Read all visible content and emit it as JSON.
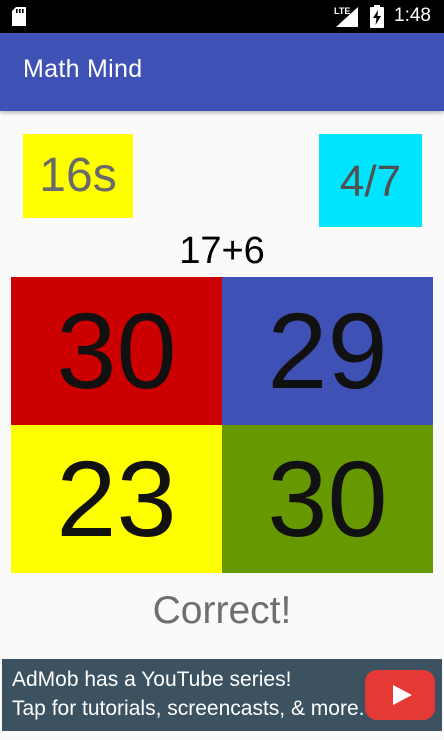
{
  "status_bar": {
    "network": "LTE",
    "time": "1:48"
  },
  "app_bar": {
    "title": "Math Mind"
  },
  "game": {
    "timer": "16s",
    "score": "4/7",
    "problem": "17+6",
    "answers": [
      "30",
      "29",
      "23",
      "30"
    ],
    "answer_colors": [
      "#cc0000",
      "#3f51b5",
      "#ffff00",
      "#669900"
    ],
    "result": "Correct!"
  },
  "ad": {
    "line1": "AdMob has a YouTube series!",
    "line2": "Tap for tutorials, screencasts, & more.",
    "icon": "youtube-play-icon"
  },
  "colors": {
    "app_bar": "#3f51b5",
    "timer_bg": "#ffff00",
    "score_bg": "#00e5ff"
  }
}
